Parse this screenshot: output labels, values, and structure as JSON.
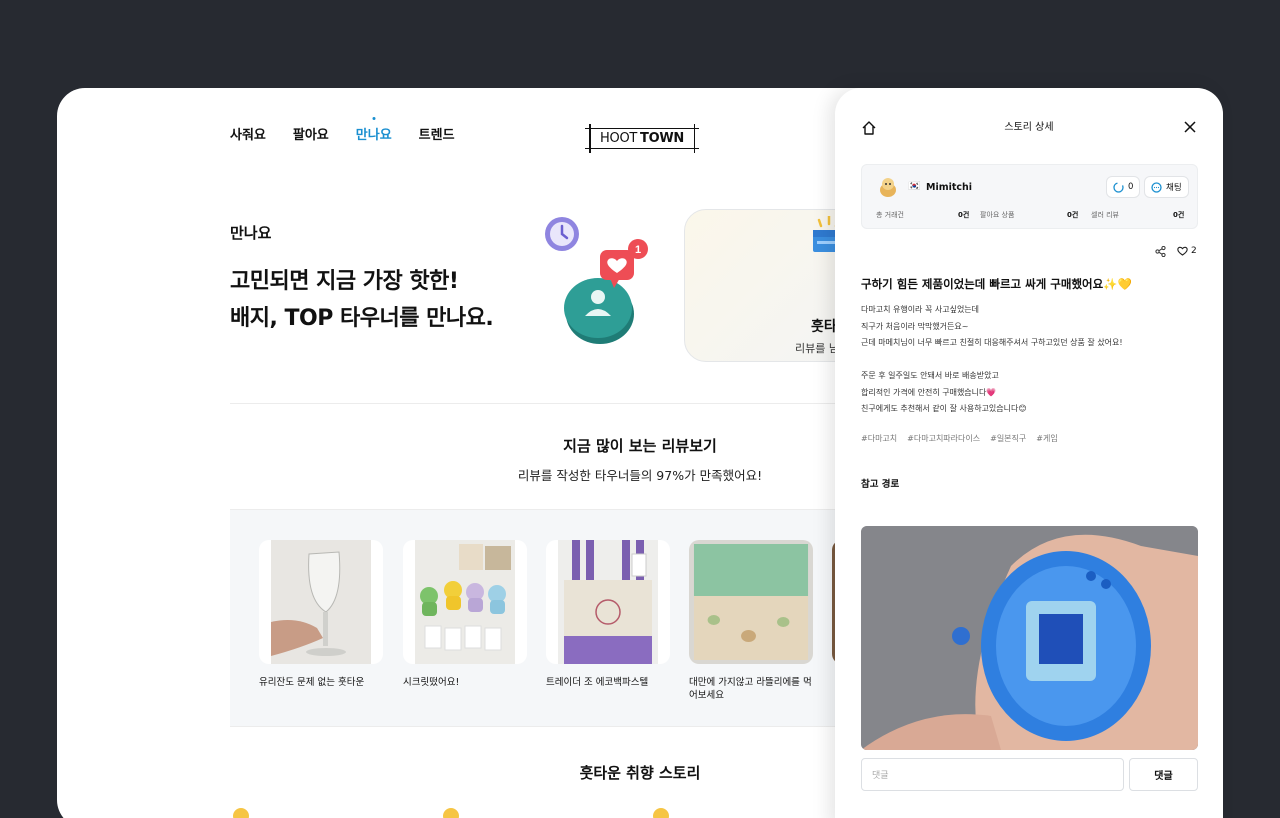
{
  "nav": {
    "items": [
      {
        "label": "사줘요",
        "active": false
      },
      {
        "label": "팔아요",
        "active": false
      },
      {
        "label": "만나요",
        "active": true
      },
      {
        "label": "트렌드",
        "active": false
      }
    ],
    "logo": {
      "part1": "HOOT",
      "part2": "TOWN"
    }
  },
  "hero": {
    "kicker": "만나요",
    "title_line1": "고민되면 지금 가장 핫한!",
    "title_line2": "배지, TOP 타우너를 만나요.",
    "badge_count": "1",
    "banner_title": "훗타",
    "banner_sub": "리뷰를 남"
  },
  "reviews": {
    "title": "지금 많이 보는 리뷰보기",
    "subtitle": "리뷰를 작성한 타우너들의 97%가 만족했어요!",
    "items": [
      {
        "label": "유리잔도 문제 없는 훗타운"
      },
      {
        "label": "시크릿떴어요!"
      },
      {
        "label": "트레이더 조 에코백파스텔"
      },
      {
        "label": "대만에 가지않고 라뜰리에를 먹어보세요"
      }
    ]
  },
  "stories": {
    "title": "훗타운 취향 스토리"
  },
  "panel": {
    "header": "스토리 상세",
    "user": {
      "flag": "🇰🇷",
      "name": "Mimitchi",
      "follow_count": "0",
      "chat_label": "채팅",
      "stats": [
        {
          "label": "총 거래건",
          "value": "0건"
        },
        {
          "label": "팔아요 상품",
          "value": "0건"
        },
        {
          "label": "셀러 리뷰",
          "value": "0건"
        }
      ]
    },
    "like_count": "2",
    "post_title": "구하기 힘든 제품이었는데 빠르고 싸게 구매했어요✨💛",
    "body_lines": [
      "다마고치 유행이라 꼭 사고싶었는데",
      "직구가 처음이라 막막했거든요~",
      "근데 마메치님이 너무 빠르고 친절히 대응해주셔서 구하고있던 상품 잘 샀어요!",
      "",
      "주문 후 일주일도 안돼서 바로 배송받았고",
      "합리적인 가격에 안전히 구매했습니다💗",
      "친구에게도 추천해서 같이 잘 사용하고있습니다😊"
    ],
    "tags": [
      "#다마고치",
      "#다마고치파라다이스",
      "#일본직구",
      "#게임"
    ],
    "ref_label": "참고 경로",
    "comment_placeholder": "댓글",
    "comment_button": "댓글"
  },
  "colors": {
    "background": "#272a31",
    "accent": "#1a8fd0",
    "illustration_teal": "#2e9e96",
    "badge_red": "#ee4d55"
  }
}
